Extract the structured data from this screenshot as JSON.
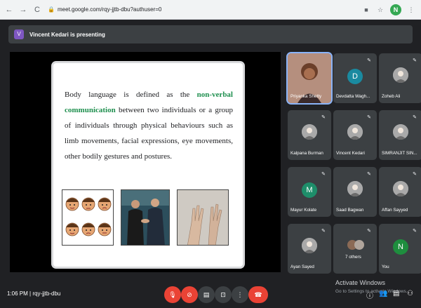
{
  "browser": {
    "url": "meet.google.com/rqy-jjtb-dbu?authuser=0",
    "profile_initial": "N",
    "back_icon": "arrow-left-icon",
    "forward_icon": "arrow-right-icon",
    "reload_icon": "reload-icon"
  },
  "banner": {
    "avatar_letter": "V",
    "text": "Vincent Kedari is presenting"
  },
  "slide": {
    "text_before": "Body language is defined as the ",
    "highlight": "non-verbal communication",
    "text_after": " between two individuals or a group of individuals through physical behaviours such as limb movements, facial expressions, eye movements, other bodily gestures and postures.",
    "highlight_color": "#1e8f4e"
  },
  "participants": [
    {
      "name": "Priyanka Shetty",
      "type": "photo",
      "speaking": true
    },
    {
      "name": "Devdatta Wagh...",
      "type": "letter",
      "letter": "D",
      "color": "#1a8aa0",
      "muted": true
    },
    {
      "name": "Zoheb Ali",
      "type": "photo",
      "muted": true
    },
    {
      "name": "Kalpana Burman",
      "type": "photo",
      "muted": true
    },
    {
      "name": "Vincent Kedari",
      "type": "photo",
      "muted": true
    },
    {
      "name": "SIMRANJIT SIN...",
      "type": "photo",
      "muted": true
    },
    {
      "name": "Mayur Kolate",
      "type": "letter",
      "letter": "M",
      "color": "#1e8e6a",
      "muted": true
    },
    {
      "name": "Saad Bagwan",
      "type": "photo",
      "muted": true
    },
    {
      "name": "Affan Sayyed",
      "type": "photo",
      "muted": true
    },
    {
      "name": "Ayan Sayed",
      "type": "photo",
      "muted": true
    },
    {
      "name": "7 others",
      "type": "group",
      "muted": true
    },
    {
      "name": "You",
      "type": "letter",
      "letter": "N",
      "color": "#1e8e3e",
      "muted": true
    }
  ],
  "bottom": {
    "time": "1:06 PM",
    "separator": "|",
    "meeting_code": "rqy-jjtb-dbu"
  },
  "watermark": {
    "title": "Activate Windows",
    "subtitle": "Go to Settings to activate Windows."
  },
  "colors": {
    "end_call": "#ea4335",
    "active_ring": "#8ab4f8"
  }
}
